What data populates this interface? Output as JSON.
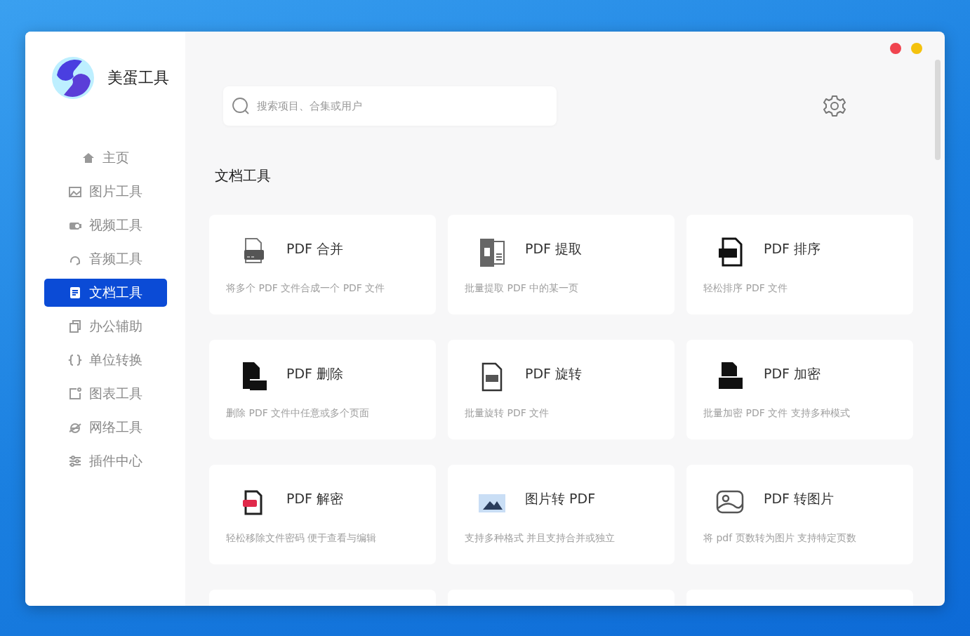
{
  "app": {
    "name": "美蛋工具"
  },
  "sidebar": {
    "items": [
      {
        "label": "主页",
        "selected": false
      },
      {
        "label": "图片工具",
        "selected": false
      },
      {
        "label": "视频工具",
        "selected": false
      },
      {
        "label": "音频工具",
        "selected": false
      },
      {
        "label": "文档工具",
        "selected": true
      },
      {
        "label": "办公辅助",
        "selected": false
      },
      {
        "label": "单位转换",
        "selected": false
      },
      {
        "label": "图表工具",
        "selected": false
      },
      {
        "label": "网络工具",
        "selected": false
      },
      {
        "label": "插件中心",
        "selected": false
      }
    ]
  },
  "search": {
    "placeholder": "搜索项目、合集或用户"
  },
  "section": {
    "title": "文档工具"
  },
  "tools": [
    {
      "title": "PDF 合并",
      "description": "将多个 PDF 文件合成一个 PDF 文件"
    },
    {
      "title": "PDF 提取",
      "description": "批量提取 PDF 中的某一页"
    },
    {
      "title": "PDF 排序",
      "description": "轻松排序 PDF 文件"
    },
    {
      "title": "PDF 删除",
      "description": "删除 PDF 文件中任意或多个页面"
    },
    {
      "title": "PDF 旋转",
      "description": "批量旋转 PDF 文件"
    },
    {
      "title": "PDF 加密",
      "description": "批量加密 PDF 文件 支持多种模式"
    },
    {
      "title": "PDF 解密",
      "description": "轻松移除文件密码 便于查看与编辑"
    },
    {
      "title": "图片转 PDF",
      "description": "支持多种格式 并且支持合并或独立"
    },
    {
      "title": "PDF 转图片",
      "description": "将 pdf 页数转为图片 支持特定页数"
    }
  ]
}
